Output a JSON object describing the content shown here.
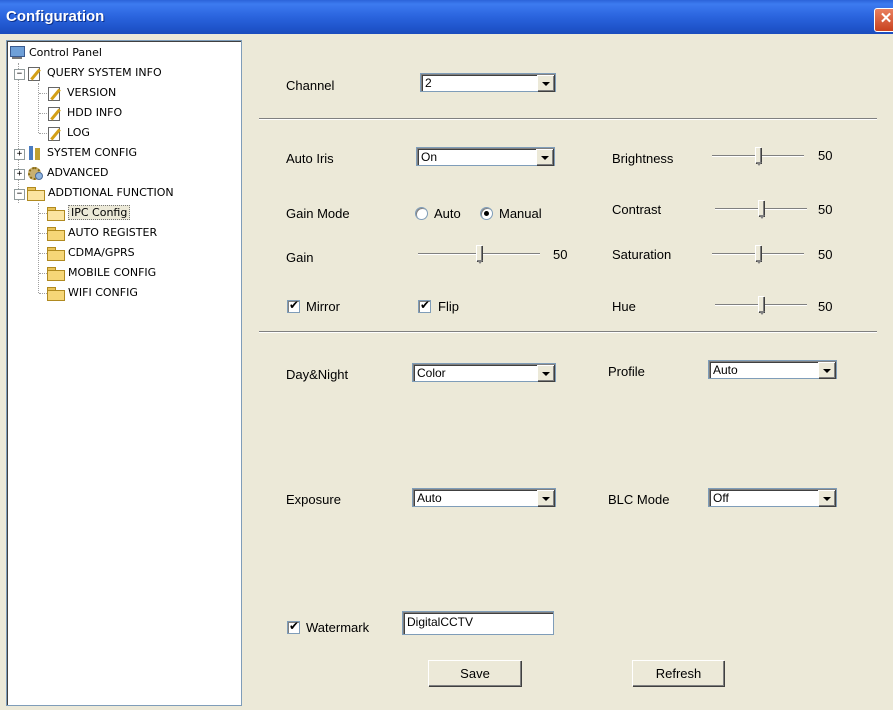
{
  "window": {
    "title": "Configuration",
    "close_icon": "close-icon"
  },
  "tree": {
    "root": {
      "label": "Control Panel",
      "icon": "computer-icon"
    },
    "query": {
      "label": "QUERY SYSTEM INFO",
      "expander": "−"
    },
    "version": {
      "label": "VERSION"
    },
    "hdd": {
      "label": "HDD INFO"
    },
    "log": {
      "label": "LOG"
    },
    "system": {
      "label": "SYSTEM CONFIG",
      "expander": "+"
    },
    "advanced": {
      "label": "ADVANCED",
      "expander": "+"
    },
    "additional": {
      "label": "ADDTIONAL FUNCTION",
      "expander": "−"
    },
    "ipc": {
      "label": "IPC Config"
    },
    "autoreg": {
      "label": "AUTO REGISTER"
    },
    "cdma": {
      "label": "CDMA/GPRS"
    },
    "mobile": {
      "label": "MOBILE CONFIG"
    },
    "wifi": {
      "label": "WIFI CONFIG"
    }
  },
  "form": {
    "channel": {
      "label": "Channel",
      "value": "2"
    },
    "auto_iris": {
      "label": "Auto Iris",
      "value": "On"
    },
    "gain_mode": {
      "label": "Gain Mode",
      "options": [
        "Auto",
        "Manual"
      ],
      "selected": "Manual"
    },
    "gain": {
      "label": "Gain",
      "value": "50",
      "level": 50
    },
    "mirror": {
      "label": "Mirror",
      "checked": true
    },
    "flip": {
      "label": "Flip",
      "checked": true
    },
    "brightness": {
      "label": "Brightness",
      "value": "50",
      "level": 50
    },
    "contrast": {
      "label": "Contrast",
      "value": "50",
      "level": 50
    },
    "saturation": {
      "label": "Saturation",
      "value": "50",
      "level": 50
    },
    "hue": {
      "label": "Hue",
      "value": "50",
      "level": 50
    },
    "day_night": {
      "label": "Day&Night",
      "value": "Color"
    },
    "profile": {
      "label": "Profile",
      "value": "Auto"
    },
    "exposure": {
      "label": "Exposure",
      "value": "Auto"
    },
    "blc_mode": {
      "label": "BLC Mode",
      "value": "Off"
    },
    "watermark": {
      "label": "Watermark",
      "checked": true,
      "value": "DigitalCCTV"
    },
    "check_mark": "✔",
    "save": "Save",
    "refresh": "Refresh"
  },
  "colors": {
    "title_bar": "#2c66e0",
    "panel_bg": "#ece9d8",
    "close_button": "#d9532c"
  }
}
